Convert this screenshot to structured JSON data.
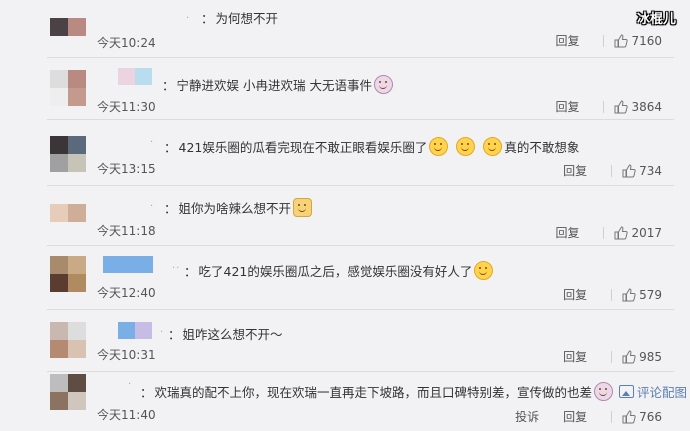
{
  "watermark": "冰棍儿",
  "comments": [
    {
      "text": "为何想不开",
      "time": "今天10:24",
      "reply": "回复",
      "likes": "7160"
    },
    {
      "text": "宁静进欢娱 小冉进欢瑞 大无语事件",
      "time": "今天11:30",
      "reply": "回复",
      "likes": "3864"
    },
    {
      "text_a": "421娱乐圈的瓜看完现在不敢正眼看娱乐圈了",
      "text_b": "真的不敢想象",
      "time": "今天13:15",
      "reply": "回复",
      "likes": "734"
    },
    {
      "text": "姐你为啥辣么想不开",
      "time": "今天11:18",
      "reply": "回复",
      "likes": "2017"
    },
    {
      "text": "吃了421的娱乐圈瓜之后，感觉娱乐圈没有好人了",
      "time": "今天12:40",
      "reply": "回复",
      "likes": "579"
    },
    {
      "text": "姐咋这么想不开～",
      "time": "今天10:31",
      "reply": "回复",
      "likes": "985"
    },
    {
      "text": "欢瑞真的配不上你，现在欢瑞一直再走下坡路，而且口碑特别差，宣传做的也差",
      "link": "评论配图",
      "time": "今天11:40",
      "report": "投诉",
      "reply": "回复",
      "likes": "766"
    }
  ],
  "icons": {
    "like": "thumbs-up-icon",
    "emoji": "smile-emoji-icon",
    "pig": "pig-emoji-icon",
    "cat": "cat-emoji-icon",
    "picture": "picture-icon"
  }
}
